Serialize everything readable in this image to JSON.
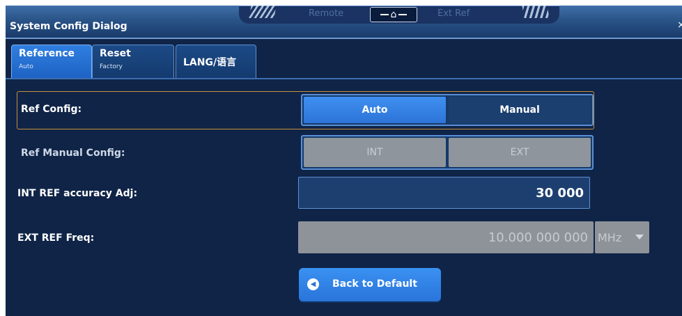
{
  "window": {
    "title": "System Config Dialog",
    "close_glyph": "×"
  },
  "status_bar": {
    "remote_label": "Remote",
    "ext_ref_label": "Ext Ref",
    "home_icon": "home-icon"
  },
  "tabs": [
    {
      "label": "Reference",
      "sublabel": "Auto",
      "active": true
    },
    {
      "label": "Reset",
      "sublabel": "Factory",
      "active": false
    },
    {
      "label": "LANG/语言",
      "sublabel": "",
      "active": false
    }
  ],
  "ref_config": {
    "label": "Ref Config:",
    "options": [
      "Auto",
      "Manual"
    ],
    "selected": "Auto"
  },
  "ref_manual_config": {
    "label": "Ref Manual Config:",
    "options": [
      "INT",
      "EXT"
    ],
    "enabled": false
  },
  "int_ref_accuracy": {
    "label": "INT REF accuracy Adj:",
    "value": "30 000"
  },
  "ext_ref_freq": {
    "label": "EXT REF Freq:",
    "value": "10.000 000 000",
    "unit": "MHz",
    "enabled": false
  },
  "back_to_default": {
    "label": "Back to Default",
    "icon": "back-to-start-icon"
  },
  "colors": {
    "background": "#0f2447",
    "accent": "#2d74d8",
    "frame_highlight": "#c8923a",
    "disabled": "#8f959c"
  }
}
